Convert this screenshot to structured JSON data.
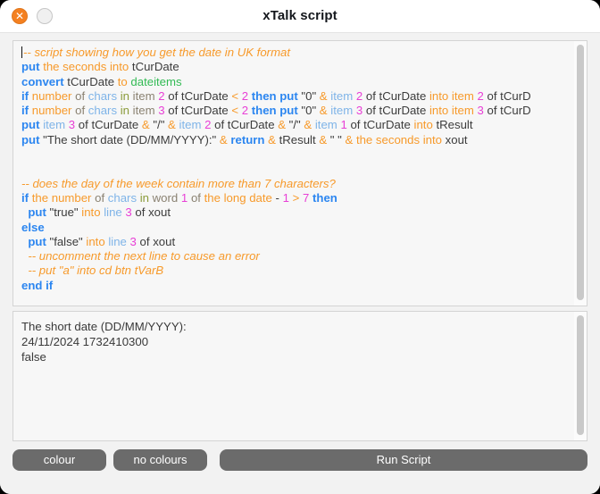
{
  "window": {
    "title": "xTalk script",
    "close_icon": "close-icon",
    "minimize_icon": "minimize-icon",
    "close_glyph": "✕"
  },
  "editor": {
    "caret_visible": true,
    "lines": [
      [
        {
          "t": "-- script showing how you get the date in UK format",
          "c": "comment"
        }
      ],
      [
        {
          "t": "put",
          "c": "kw"
        },
        {
          "t": " ",
          "c": "var"
        },
        {
          "t": "the seconds",
          "c": "cmd"
        },
        {
          "t": " ",
          "c": "var"
        },
        {
          "t": "into",
          "c": "cmd"
        },
        {
          "t": " tCurDate",
          "c": "var"
        }
      ],
      [
        {
          "t": "convert",
          "c": "kw"
        },
        {
          "t": " tCurDate ",
          "c": "var"
        },
        {
          "t": "to",
          "c": "cmd"
        },
        {
          "t": " ",
          "c": "var"
        },
        {
          "t": "dateitems",
          "c": "green"
        }
      ],
      [
        {
          "t": "if",
          "c": "kw"
        },
        {
          "t": " ",
          "c": "var"
        },
        {
          "t": "number",
          "c": "cmd"
        },
        {
          "t": " ",
          "c": "var"
        },
        {
          "t": "of",
          "c": "of"
        },
        {
          "t": " ",
          "c": "var"
        },
        {
          "t": "chars",
          "c": "chars"
        },
        {
          "t": " ",
          "c": "var"
        },
        {
          "t": "in",
          "c": "in"
        },
        {
          "t": " ",
          "c": "var"
        },
        {
          "t": "item",
          "c": "of"
        },
        {
          "t": " ",
          "c": "var"
        },
        {
          "t": "2",
          "c": "num"
        },
        {
          "t": " of tCurDate ",
          "c": "var"
        },
        {
          "t": "<",
          "c": "cmp"
        },
        {
          "t": " ",
          "c": "var"
        },
        {
          "t": "2",
          "c": "num"
        },
        {
          "t": " ",
          "c": "var"
        },
        {
          "t": "then put",
          "c": "kw"
        },
        {
          "t": " \"0\" ",
          "c": "var"
        },
        {
          "t": "&",
          "c": "amp"
        },
        {
          "t": " ",
          "c": "var"
        },
        {
          "t": "item",
          "c": "chars"
        },
        {
          "t": " ",
          "c": "var"
        },
        {
          "t": "2",
          "c": "num"
        },
        {
          "t": " of tCurDate ",
          "c": "var"
        },
        {
          "t": "into",
          "c": "cmd"
        },
        {
          "t": " ",
          "c": "var"
        },
        {
          "t": "item",
          "c": "cmd"
        },
        {
          "t": " ",
          "c": "var"
        },
        {
          "t": "2",
          "c": "num"
        },
        {
          "t": " of tCurD",
          "c": "var"
        }
      ],
      [
        {
          "t": "if",
          "c": "kw"
        },
        {
          "t": " ",
          "c": "var"
        },
        {
          "t": "number",
          "c": "cmd"
        },
        {
          "t": " ",
          "c": "var"
        },
        {
          "t": "of",
          "c": "of"
        },
        {
          "t": " ",
          "c": "var"
        },
        {
          "t": "chars",
          "c": "chars"
        },
        {
          "t": " ",
          "c": "var"
        },
        {
          "t": "in",
          "c": "in"
        },
        {
          "t": " ",
          "c": "var"
        },
        {
          "t": "item",
          "c": "of"
        },
        {
          "t": " ",
          "c": "var"
        },
        {
          "t": "3",
          "c": "num"
        },
        {
          "t": " of tCurDate ",
          "c": "var"
        },
        {
          "t": "<",
          "c": "cmp"
        },
        {
          "t": " ",
          "c": "var"
        },
        {
          "t": "2",
          "c": "num"
        },
        {
          "t": " ",
          "c": "var"
        },
        {
          "t": "then put",
          "c": "kw"
        },
        {
          "t": " \"0\" ",
          "c": "var"
        },
        {
          "t": "&",
          "c": "amp"
        },
        {
          "t": " ",
          "c": "var"
        },
        {
          "t": "item",
          "c": "chars"
        },
        {
          "t": " ",
          "c": "var"
        },
        {
          "t": "3",
          "c": "num"
        },
        {
          "t": " of tCurDate ",
          "c": "var"
        },
        {
          "t": "into",
          "c": "cmd"
        },
        {
          "t": " ",
          "c": "var"
        },
        {
          "t": "item",
          "c": "cmd"
        },
        {
          "t": " ",
          "c": "var"
        },
        {
          "t": "3",
          "c": "num"
        },
        {
          "t": " of tCurD",
          "c": "var"
        }
      ],
      [
        {
          "t": "put",
          "c": "kw"
        },
        {
          "t": " ",
          "c": "var"
        },
        {
          "t": "item",
          "c": "chars"
        },
        {
          "t": " ",
          "c": "var"
        },
        {
          "t": "3",
          "c": "num"
        },
        {
          "t": " of tCurDate ",
          "c": "var"
        },
        {
          "t": "&",
          "c": "amp"
        },
        {
          "t": " \"/\" ",
          "c": "var"
        },
        {
          "t": "&",
          "c": "amp"
        },
        {
          "t": " ",
          "c": "var"
        },
        {
          "t": "item",
          "c": "chars"
        },
        {
          "t": " ",
          "c": "var"
        },
        {
          "t": "2",
          "c": "num"
        },
        {
          "t": " of tCurDate ",
          "c": "var"
        },
        {
          "t": "&",
          "c": "amp"
        },
        {
          "t": " \"/\" ",
          "c": "var"
        },
        {
          "t": "&",
          "c": "amp"
        },
        {
          "t": " ",
          "c": "var"
        },
        {
          "t": "item",
          "c": "chars"
        },
        {
          "t": " ",
          "c": "var"
        },
        {
          "t": "1",
          "c": "num"
        },
        {
          "t": " of tCurDate ",
          "c": "var"
        },
        {
          "t": "into",
          "c": "cmd"
        },
        {
          "t": " tResult",
          "c": "var"
        }
      ],
      [
        {
          "t": "put",
          "c": "kw"
        },
        {
          "t": " \"The short date (DD/MM/YYYY):\" ",
          "c": "var"
        },
        {
          "t": "&",
          "c": "amp"
        },
        {
          "t": " ",
          "c": "var"
        },
        {
          "t": "return",
          "c": "kw"
        },
        {
          "t": " ",
          "c": "var"
        },
        {
          "t": "&",
          "c": "amp"
        },
        {
          "t": " tResult ",
          "c": "var"
        },
        {
          "t": "&",
          "c": "amp"
        },
        {
          "t": " \" \" ",
          "c": "var"
        },
        {
          "t": "&",
          "c": "amp"
        },
        {
          "t": " ",
          "c": "var"
        },
        {
          "t": "the seconds",
          "c": "cmd"
        },
        {
          "t": " ",
          "c": "var"
        },
        {
          "t": "into",
          "c": "cmd"
        },
        {
          "t": " xout",
          "c": "var"
        }
      ],
      [],
      [],
      [
        {
          "t": "-- does the day of the week contain more than 7 characters?",
          "c": "comment"
        }
      ],
      [
        {
          "t": "if",
          "c": "kw"
        },
        {
          "t": " ",
          "c": "var"
        },
        {
          "t": "the number",
          "c": "cmd"
        },
        {
          "t": " ",
          "c": "var"
        },
        {
          "t": "of",
          "c": "of"
        },
        {
          "t": " ",
          "c": "var"
        },
        {
          "t": "chars",
          "c": "chars"
        },
        {
          "t": " ",
          "c": "var"
        },
        {
          "t": "in",
          "c": "in"
        },
        {
          "t": " ",
          "c": "var"
        },
        {
          "t": "word",
          "c": "of"
        },
        {
          "t": " ",
          "c": "var"
        },
        {
          "t": "1",
          "c": "num"
        },
        {
          "t": " ",
          "c": "var"
        },
        {
          "t": "of",
          "c": "of"
        },
        {
          "t": " ",
          "c": "var"
        },
        {
          "t": "the long date",
          "c": "cmd"
        },
        {
          "t": " - ",
          "c": "var"
        },
        {
          "t": "1",
          "c": "num"
        },
        {
          "t": " ",
          "c": "var"
        },
        {
          "t": ">",
          "c": "cmp"
        },
        {
          "t": " ",
          "c": "var"
        },
        {
          "t": "7",
          "c": "num"
        },
        {
          "t": " ",
          "c": "var"
        },
        {
          "t": "then",
          "c": "kw"
        }
      ],
      [
        {
          "t": "  ",
          "c": "var"
        },
        {
          "t": "put",
          "c": "kw"
        },
        {
          "t": " \"true\" ",
          "c": "var"
        },
        {
          "t": "into",
          "c": "cmd"
        },
        {
          "t": " ",
          "c": "var"
        },
        {
          "t": "line",
          "c": "chars"
        },
        {
          "t": " ",
          "c": "var"
        },
        {
          "t": "3",
          "c": "num"
        },
        {
          "t": " of xout",
          "c": "var"
        }
      ],
      [
        {
          "t": "else",
          "c": "kw"
        }
      ],
      [
        {
          "t": "  ",
          "c": "var"
        },
        {
          "t": "put",
          "c": "kw"
        },
        {
          "t": " \"false\" ",
          "c": "var"
        },
        {
          "t": "into",
          "c": "cmd"
        },
        {
          "t": " ",
          "c": "var"
        },
        {
          "t": "line",
          "c": "chars"
        },
        {
          "t": " ",
          "c": "var"
        },
        {
          "t": "3",
          "c": "num"
        },
        {
          "t": " of xout",
          "c": "var"
        }
      ],
      [
        {
          "t": "  -- uncomment the next line to cause an error",
          "c": "comment"
        }
      ],
      [
        {
          "t": "  -- put \"a\" into cd btn tVarB",
          "c": "comment"
        }
      ],
      [
        {
          "t": "end if",
          "c": "kw"
        }
      ]
    ]
  },
  "output": {
    "lines": [
      "The short date (DD/MM/YYYY):",
      "24/11/2024 1732410300",
      "false"
    ]
  },
  "buttons": {
    "colour": "colour",
    "no_colours": "no colours",
    "run_script": "Run Script"
  }
}
